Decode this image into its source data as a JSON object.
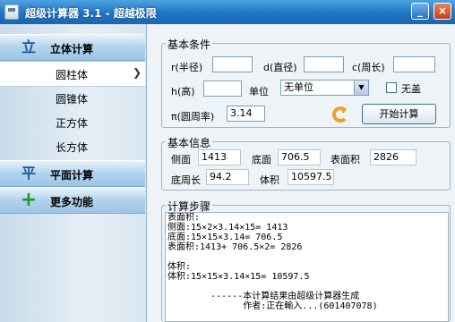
{
  "window": {
    "title": "超级计算器 3.1 - 超越极限"
  },
  "sidebar": {
    "sections": [
      {
        "label": "立体计算",
        "icon": "立"
      },
      {
        "label": "平面计算",
        "icon": "平"
      },
      {
        "label": "更多功能",
        "icon": "+"
      }
    ],
    "items": [
      {
        "label": "圆柱体"
      },
      {
        "label": "圆锥体"
      },
      {
        "label": "正方体"
      },
      {
        "label": "长方体"
      }
    ]
  },
  "conditions": {
    "legend": "基本条件",
    "r_label": "r(半径)",
    "r_value": "",
    "d_label": "d(直径)",
    "d_value": "",
    "c_label": "c(周长)",
    "c_value": "",
    "h_label": "h(高)",
    "h_value": "",
    "unit_label": "单位",
    "unit_value": "无单位",
    "no_cover_label": "无盖",
    "pi_label": "π(圆周率)",
    "pi_value": "3.14",
    "start_button": "开始计算"
  },
  "info": {
    "legend": "基本信息",
    "side_label": "侧面",
    "side_value": "1413",
    "base_label": "底面",
    "base_value": "706.5",
    "surface_label": "表面积",
    "surface_value": "2826",
    "perimeter_label": "底周长",
    "perimeter_value": "94.2",
    "volume_label": "体积",
    "volume_value": "10597.5"
  },
  "steps": {
    "legend": "计算步骤",
    "lines": [
      "表面积:",
      "侧面:15×2×3.14×15= 1413",
      "底面:15×15×3.14= 706.5",
      "表面积:1413+ 706.5×2= 2826",
      "",
      "体积:",
      "体积:15×15×3.14×15= 10597.5",
      "",
      "        ------本计算结果由超级计算器生成",
      "              作者:正在輸入...(601407078)"
    ]
  }
}
